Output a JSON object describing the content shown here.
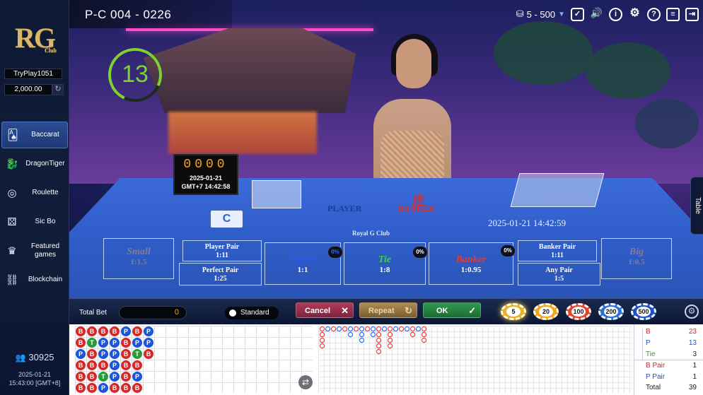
{
  "sidebar": {
    "logo": "RG",
    "logo_sub": "Club",
    "username": "TryPlay1051",
    "balance": "2,000.00",
    "nav": [
      {
        "label": "Baccarat",
        "icon": "cards-icon",
        "active": true
      },
      {
        "label": "DragonTiger",
        "icon": "dragon-icon"
      },
      {
        "label": "Roulette",
        "icon": "roulette-icon"
      },
      {
        "label": "Sic Bo",
        "icon": "dice-icon"
      },
      {
        "label": "Featured games",
        "icon": "crown-icon"
      },
      {
        "label": "Blockchain",
        "icon": "chain-icon"
      }
    ],
    "online_count": "30925",
    "date": "2025-01-21",
    "time": "15:43:00 [GMT+8]"
  },
  "header": {
    "table_id": "P-C 004 - 0226",
    "limit": "5 - 500",
    "icons": [
      "chips-icon",
      "shield-icon",
      "sound-icon",
      "info-icon",
      "gear-icon",
      "help-icon",
      "history-icon",
      "exit-icon"
    ]
  },
  "video": {
    "countdown": "13",
    "scoreboard_digits": "0000",
    "scoreboard_date": "2025-01-21",
    "scoreboard_time": "GMT+7 14:42:58",
    "felt_date": "2025-01-21 14:42:59",
    "card_letter": "C",
    "felt_player": "PLAYER",
    "felt_banker": "BANKER",
    "felt_banker_zh": "庄",
    "felt_logo": "Royal G Club",
    "table_tab": "Table"
  },
  "bets": {
    "small": {
      "name": "Small",
      "odds": "1:1.5"
    },
    "player_pair": {
      "name": "Player Pair",
      "odds": "1:11"
    },
    "perfect_pair": {
      "name": "Perfect Pair",
      "odds": "1:25"
    },
    "player": {
      "name": "Player",
      "odds": "1:1",
      "pct": "0%"
    },
    "tie": {
      "name": "Tie",
      "odds": "1:8",
      "pct": "0%"
    },
    "banker": {
      "name": "Banker",
      "odds": "1:0.95",
      "pct": "0%"
    },
    "banker_pair": {
      "name": "Banker Pair",
      "odds": "1:11"
    },
    "any_pair": {
      "name": "Any Pair",
      "odds": "1:5"
    },
    "big": {
      "name": "Big",
      "odds": "1:0.5"
    }
  },
  "controls": {
    "total_bet_label": "Total Bet",
    "total_bet_value": "0",
    "mode_label": "Standard",
    "cancel": "Cancel",
    "repeat": "Repeat",
    "ok": "OK",
    "chips": [
      {
        "value": "5",
        "color": "#e8b020"
      },
      {
        "value": "20",
        "color": "#f2a51a"
      },
      {
        "value": "100",
        "color": "#e0452a"
      },
      {
        "value": "200",
        "color": "#2b6fd8"
      },
      {
        "value": "500",
        "color": "#1f50c8"
      }
    ]
  },
  "bead_road": [
    [
      "B",
      "B",
      "B",
      "B",
      "P",
      "B",
      "P"
    ],
    [
      "B",
      "T",
      "P",
      "P",
      "B",
      "P",
      "P"
    ],
    [
      "P",
      "B",
      "P",
      "P",
      "B",
      "T",
      "B"
    ],
    [
      "B",
      "B",
      "B",
      "P",
      "B",
      "B"
    ],
    [
      "B",
      "B",
      "T",
      "P",
      "B",
      "P"
    ],
    [
      "B",
      "B",
      "P",
      "B",
      "B",
      "B"
    ]
  ],
  "stats": {
    "rows": [
      {
        "label": "B",
        "value": "23",
        "color": "#d22"
      },
      {
        "label": "P",
        "value": "13",
        "color": "#1a55d8"
      },
      {
        "label": "Tie",
        "value": "3",
        "color": "#2a9a3a"
      },
      {
        "label": "B Pair",
        "value": "1",
        "color": "#d22"
      },
      {
        "label": "P Pair",
        "value": "1",
        "color": "#1a55d8"
      },
      {
        "label": "Total",
        "value": "39",
        "color": "#222"
      }
    ]
  },
  "colors": {
    "banker": "#d42a2a",
    "player": "#1a55d8",
    "tie": "#2a9a3a",
    "timer": "#7ed035",
    "accent": "#ff9f1c"
  }
}
